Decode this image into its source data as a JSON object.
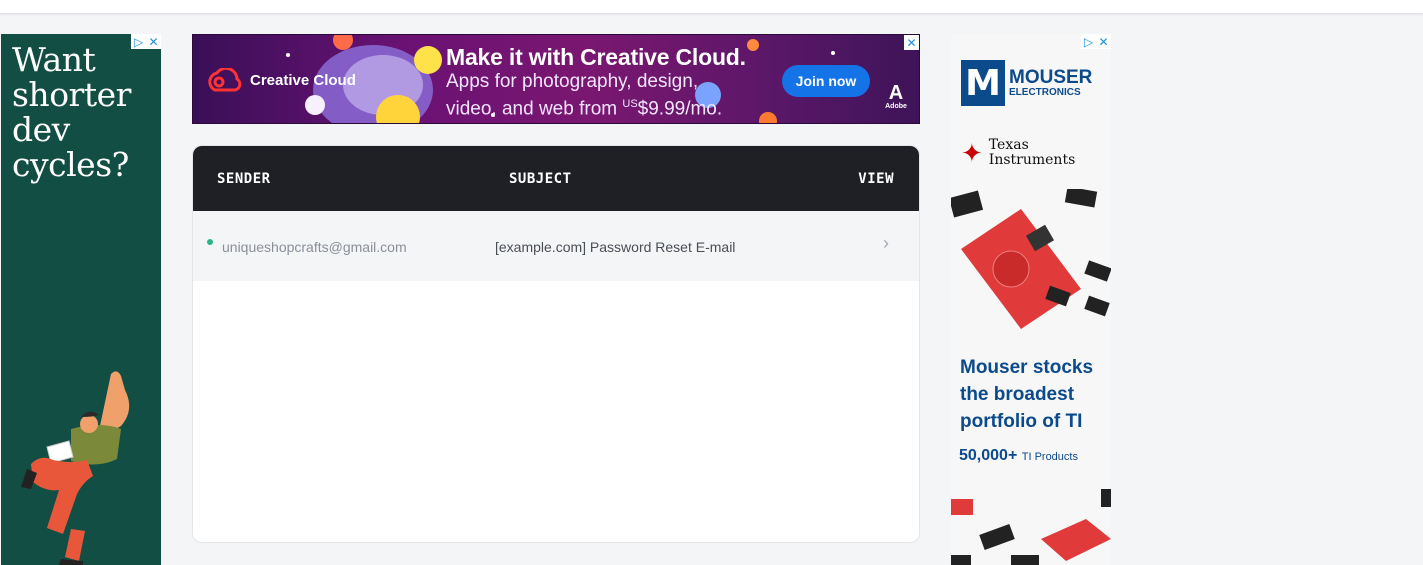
{
  "ads": {
    "left": {
      "headline": "Want shorter dev cycles?",
      "adchoices_icon": "adchoices-icon",
      "close_icon": "close-icon"
    },
    "top": {
      "brand": "Creative Cloud",
      "headline": "Make it with Creative Cloud.",
      "subline_1": "Apps for photography, design,",
      "subline_2_pre": "video, and web from ",
      "subline_2_currency": "US",
      "subline_2_price": "$9.99/mo.",
      "cta": "Join now",
      "adobe_label": "Adobe",
      "close_icon": "close-icon"
    },
    "right": {
      "mouser_brand": "MOUSER",
      "mouser_sub": "ELECTRONICS",
      "ti_line1": "Texas",
      "ti_line2": "Instruments",
      "tagline": "Mouser stocks the broadest portfolio of TI",
      "stat_number": "50,000+",
      "stat_label": "TI Products"
    }
  },
  "inbox": {
    "columns": {
      "sender": "SENDER",
      "subject": "SUBJECT",
      "view": "VIEW"
    },
    "rows": [
      {
        "sender": "uniqueshopcrafts@gmail.com",
        "subject": "[example.com] Password Reset E-mail",
        "unread": true,
        "icon": "chevron-right-icon"
      }
    ]
  },
  "colors": {
    "header_bg": "#1e2025",
    "unread_dot": "#2bb48a",
    "page_bg": "#f4f5f7",
    "join_button": "#1473e6",
    "mouser_blue": "#0b4a8b"
  }
}
